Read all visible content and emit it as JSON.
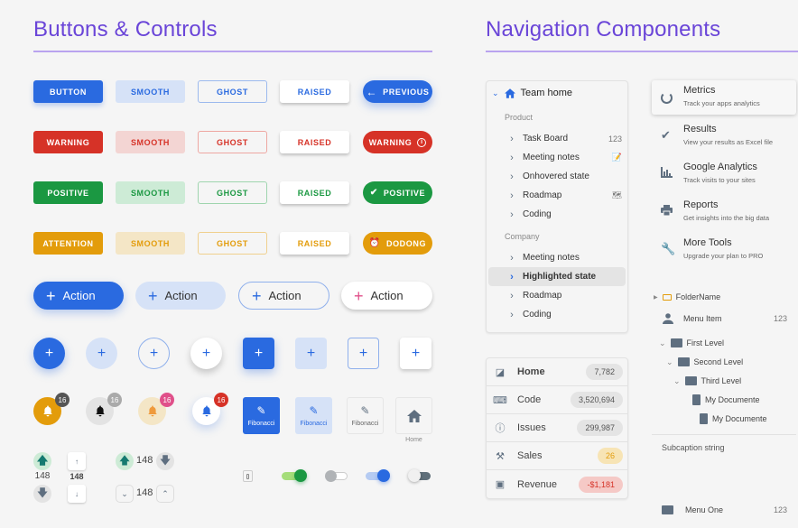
{
  "sections": {
    "buttons_title": "Buttons & Controls",
    "nav_title": "Navigation Components"
  },
  "colors": {
    "heading": "#6a45d8",
    "primary": "#2a6ae0",
    "danger": "#d63227",
    "positive": "#1b9842",
    "attention": "#e39c0b"
  },
  "button_rows": [
    {
      "variant": "primary",
      "solid": "BUTTON",
      "smooth": "SMOOTH",
      "ghost": "GHOST",
      "raised": "RAISED",
      "pill": "PREVIOUS",
      "pill_icon": "arrow-left-icon"
    },
    {
      "variant": "danger",
      "solid": "WARNING",
      "smooth": "SMOOTH",
      "ghost": "GHOST",
      "raised": "RAISED",
      "pill": "WARNING",
      "pill_icon": "info-icon"
    },
    {
      "variant": "positive",
      "solid": "POSITIVE",
      "smooth": "SMOOTH",
      "ghost": "GHOST",
      "raised": "RAISED",
      "pill": "POSITIVE",
      "pill_icon": "check-icon"
    },
    {
      "variant": "attention",
      "solid": "ATTENTION",
      "smooth": "SMOOTH",
      "ghost": "GHOST",
      "raised": "RAISED",
      "pill": "DODONG",
      "pill_icon": "alarm-icon"
    }
  ],
  "action_buttons": [
    "Action",
    "Action",
    "Action",
    "Action"
  ],
  "notification_badges": [
    "16",
    "16",
    "16",
    "16"
  ],
  "tiles": [
    "Fibonacci",
    "Fibonacci",
    "Fibonacci"
  ],
  "home_tile_label": "Home",
  "counters": [
    "148",
    "148",
    "148",
    "148"
  ],
  "toggles": [
    {
      "state": "on",
      "color": "green"
    },
    {
      "state": "off",
      "color": "grey"
    },
    {
      "state": "on",
      "color": "blue"
    },
    {
      "state": "off",
      "color": "dark"
    }
  ],
  "sidebar_nav": {
    "root": "Team home",
    "groups": [
      {
        "label": "Product",
        "items": [
          {
            "label": "Task Board",
            "count": "123"
          },
          {
            "label": "Meeting notes",
            "icon": "memo-icon"
          },
          {
            "label": "Onhovered state"
          },
          {
            "label": "Roadmap",
            "icon": "map-icon"
          },
          {
            "label": "Coding"
          }
        ]
      },
      {
        "label": "Company",
        "items": [
          {
            "label": "Meeting notes"
          },
          {
            "label": "Highlighted state",
            "active": true
          },
          {
            "label": "Roadmap"
          },
          {
            "label": "Coding"
          }
        ]
      }
    ]
  },
  "stats": [
    {
      "label": "Home",
      "value": "7,782"
    },
    {
      "label": "Code",
      "value": "3,520,694"
    },
    {
      "label": "Issues",
      "value": "299,987"
    },
    {
      "label": "Sales",
      "value": "26"
    },
    {
      "label": "Revenue",
      "value": "-$1,181"
    }
  ],
  "menu_items": [
    {
      "title": "Metrics",
      "subtitle": "Track your apps analytics"
    },
    {
      "title": "Results",
      "subtitle": "View your results as Excel file"
    },
    {
      "title": "Google Analytics",
      "subtitle": "Track visits to your sites"
    },
    {
      "title": "Reports",
      "subtitle": "Get insights into the big data"
    },
    {
      "title": "More Tools",
      "subtitle": "Upgrade your plan to PRO"
    }
  ],
  "tree": {
    "folder": "FolderName",
    "menu_item": "Menu Item",
    "menu_item_count": "123",
    "first": "First Level",
    "second": "Second Level",
    "third": "Third Level",
    "doc1": "My Documente",
    "doc2": "My Documente",
    "subcaption": "Subcaption string",
    "menu_one": "Menu One",
    "menu_one_count": "123"
  }
}
